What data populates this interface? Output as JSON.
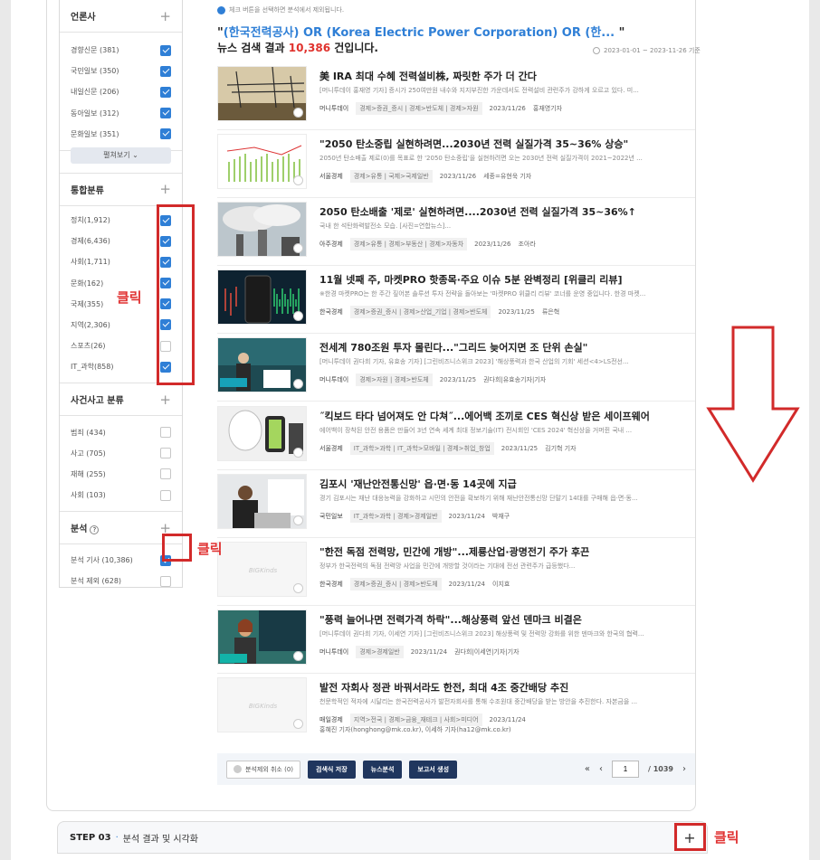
{
  "notice": "체크 버튼을 선택하면 분석에서 제외됩니다.",
  "query": {
    "blue": "(한국전력공사) OR (Korea Electric Power Corporation) OR (한...",
    "open": "\"",
    "close": " \""
  },
  "count": {
    "prefix": "뉴스 검색 결과 ",
    "number": "10,386",
    "suffix": " 건입니다."
  },
  "date_range": "2023-01-01 ~ 2023-11-26 기준",
  "sidebar": {
    "press": {
      "title": "언론사",
      "items": [
        {
          "label": "경향신문 (381)",
          "checked": true
        },
        {
          "label": "국민일보 (350)",
          "checked": true
        },
        {
          "label": "내일신문 (206)",
          "checked": true
        },
        {
          "label": "동아일보 (312)",
          "checked": true
        },
        {
          "label": "문화일보 (351)",
          "checked": true
        }
      ],
      "all_button": "펼쳐보기 ⌄"
    },
    "integrated": {
      "title": "통합분류",
      "items": [
        {
          "label": "정치(1,912)",
          "checked": true
        },
        {
          "label": "경제(6,436)",
          "checked": true
        },
        {
          "label": "사회(1,711)",
          "checked": true
        },
        {
          "label": "문화(162)",
          "checked": true
        },
        {
          "label": "국제(355)",
          "checked": true
        },
        {
          "label": "지역(2,306)",
          "checked": true
        },
        {
          "label": "스포츠(26)",
          "checked": false
        },
        {
          "label": "IT_과학(858)",
          "checked": true
        }
      ]
    },
    "incident": {
      "title": "사건사고 분류",
      "items": [
        {
          "label": "범죄 (434)",
          "checked": false
        },
        {
          "label": "사고 (705)",
          "checked": false
        },
        {
          "label": "재해 (255)",
          "checked": false
        },
        {
          "label": "사회 (103)",
          "checked": false
        }
      ]
    },
    "analysis": {
      "title": "분석",
      "help": "?",
      "items": [
        {
          "label": "분석 기사 (10,386)",
          "checked": true
        },
        {
          "label": "분석 제외 (628)",
          "checked": false
        }
      ]
    },
    "plus": "+"
  },
  "articles": [
    {
      "title": "美 IRA 최대 수혜 전력설비株, 짜릿한 주가 더 간다",
      "summary": "[머니투데이 홍재영 기자] 증시가 250여만원 내수와 지지부진한 가운데서도 전력설비 관련주가 강하게 오르고 있다. 미...",
      "source": "머니투데이",
      "category": "경제>증권_증시 | 경제>반도체 | 경제>자원",
      "date": "2023/11/26",
      "author": "홍재영기자",
      "extra": ""
    },
    {
      "title": "\"2050 탄소중립 실현하려면...2030년 전력 실질가격 35~36% 상승\"",
      "summary": "2050년 탄소배출 제로(0)를 목표로 한 '2050 탄소중립'을 실현하려면 오는 2030년 전력 실질가격이 2021~2022년 ...",
      "source": "서울경제",
      "category": "경제>유통 | 국제>국제일반",
      "date": "2023/11/26",
      "author": "세종=유현욱 기자",
      "extra": ""
    },
    {
      "title": "2050 탄소배출 '제로' 실현하려면....2030년 전력 실질가격 35~36%↑",
      "summary": "국내 한 석탄화력발전소 모습. [사진=연합뉴스]...",
      "source": "아주경제",
      "category": "경제>유통 | 경제>부동산 | 경제>자동차",
      "date": "2023/11/26",
      "author": "조아라",
      "extra": ""
    },
    {
      "title": "11월 넷째 주, 마켓PRO 핫종목·주요 이슈 5분 완벽정리 [위클리 리뷰]",
      "summary": "※한경 마켓PRO는 한 주간 짚어본 솔루션 투자 전략을 돌아보는 '마켓PRO 위클리 리뷰' 코너를 운영 중입니다. 한경 마켓...",
      "source": "한국경제",
      "category": "경제>증권_증시 | 경제>산업_기업 | 경제>반도체",
      "date": "2023/11/25",
      "author": "류은혁",
      "extra": ""
    },
    {
      "title": "전세계 780조원 투자 몰린다...\"그리드 늦어지면 조 단위 손실\"",
      "summary": "[머니투데이 권다희 기자, 유효송 기자] [그린비즈니스위크 2023] '해상풍력과 한국 산업의 기회' 세션<4>LS전선...",
      "source": "머니투데이",
      "category": "경제>자원 | 경제>반도체",
      "date": "2023/11/25",
      "author": "권다희|유효송기자|기자",
      "extra": ""
    },
    {
      "title": "˝킥보드 타다 넘어져도 안 다쳐˝...에어백 조끼로 CES 혁신상 받은 세이프웨어",
      "summary": "에어백이 장착된 안전 용품은 만들어 3년 연속 세계 최대 정보기술(IT) 전시회인 'CES 2024' 혁신상을 거머쥔 국내 ...",
      "source": "서울경제",
      "category": "IT_과학>과학 | IT_과학>모바일 | 경제>취업_창업",
      "date": "2023/11/25",
      "author": "김기혁 기자",
      "extra": ""
    },
    {
      "title": "김포시 '재난안전통신망' 읍·면·동 14곳에 지급",
      "summary": "경기 김포시는 재난 대응능력을 강화하고 시민의 안전을 확보하기 위해 재난안전통신망 단말기 14대를 구매해 읍·면·동...",
      "source": "국민일보",
      "category": "IT_과학>과학 | 경제>경제일반",
      "date": "2023/11/24",
      "author": "박재구",
      "extra": ""
    },
    {
      "title": "\"한전 독점 전력망, 민간에 개방\"...제룡산업·광명전기 주가 후끈",
      "summary": "정부가 한국전력의 독점 전력망 사업을 민간에 개방할 것이라는 기대에 전선 관련주가 급등했다...",
      "source": "한국경제",
      "category": "경제>증권_증시 | 경제>반도체",
      "date": "2023/11/24",
      "author": "이지효",
      "extra": ""
    },
    {
      "title": "\"풍력 늘어나면 전력가격 하락\"...해상풍력 앞선 덴마크 비결은",
      "summary": "[머니투데이 권다희 기자, 이세연 기자] [그린비즈니스위크 2023] 해상풍력 및 전력망 강화를 위한 덴마크와 한국의 협력...",
      "source": "머니투데이",
      "category": "경제>경제일반",
      "date": "2023/11/24",
      "author": "권다희|이세연|기자|기자",
      "extra": ""
    },
    {
      "title": "발전 자회사 정관 바꿔서라도 한전, 최대 4조 중간배당 추진",
      "summary": "천문학적인 적자에 시달리는 한국전력공사가 발전자회사를 통해 수조원대 중간배당을 받는 방안을 추진한다. 자본금을 ...",
      "source": "매일경제",
      "category": "지역>전국 | 경제>금융_재테크 | 사회>미디어",
      "date": "2023/11/24",
      "author": "",
      "extra": "홍혜진 기자(honghong@mk.co.kr), 이세하 기자(ha12@mk.co.kr)"
    }
  ],
  "thumb_placeholder": "BIGKinds",
  "bottom": {
    "exclude_cancel": "분석제외 취소 (0)",
    "save_query": "검색식 저장",
    "news_analysis": "뉴스분석",
    "report": "보고서 생성",
    "first": "«",
    "prev": "‹",
    "next": "›",
    "page": "1",
    "total": "/ 1039"
  },
  "step": {
    "label": "STEP 03",
    "dot": "·",
    "sub": "분석 결과 및 시각화",
    "plus": "+"
  },
  "annotations": {
    "click1": "클릭",
    "click2": "클릭",
    "click3": "클릭"
  },
  "colors": {
    "accent": "#2f7fd6",
    "count_red": "#e0322d",
    "navy": "#20365e",
    "annotation": "#d22a2a"
  }
}
